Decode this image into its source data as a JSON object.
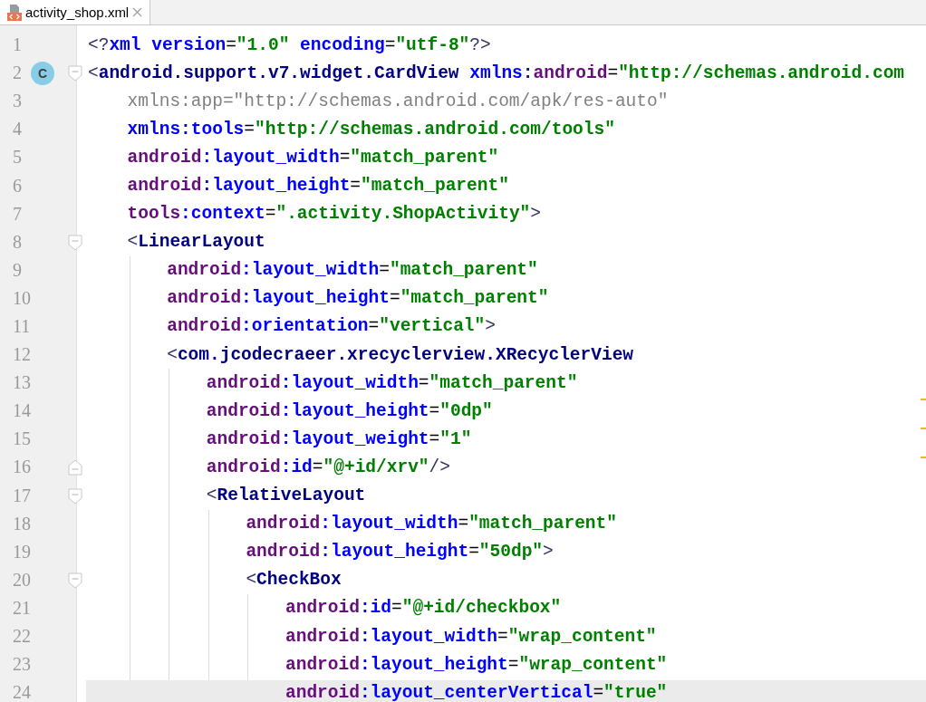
{
  "tabs": [
    {
      "label": "activity_shop.xml",
      "selected": true,
      "closable": true
    }
  ],
  "editor": {
    "lines": [
      {
        "number": "1",
        "current": false,
        "fold_marker": false,
        "tokens": [
          {
            "kind": "bracket",
            "text": "<?"
          },
          {
            "kind": "attr",
            "text": "xml version"
          },
          {
            "kind": "plain",
            "text": "="
          },
          {
            "kind": "value",
            "text": "\"1.0\""
          },
          {
            "kind": "attr",
            "text": " encoding"
          },
          {
            "kind": "plain",
            "text": "="
          },
          {
            "kind": "value",
            "text": "\"utf-8\""
          },
          {
            "kind": "bracket",
            "text": "?>"
          }
        ]
      },
      {
        "number": "2",
        "current": false,
        "fold_marker": true,
        "badge": "C",
        "tokens": [
          {
            "kind": "bracket",
            "text": "<"
          },
          {
            "kind": "tag",
            "text": "android.support.v7.widget.CardView"
          },
          {
            "kind": "attr",
            "text": " xmlns:"
          },
          {
            "kind": "ns",
            "text": "android"
          },
          {
            "kind": "plain",
            "text": "="
          },
          {
            "kind": "value",
            "text": "\"http://schemas.android.com"
          }
        ],
        "children": [
          {
            "number": "3",
            "current": false,
            "fold_marker": false,
            "tokens": [
              {
                "kind": "unused",
                "text": "xmlns:app=\"http://schemas.android.com/apk/res-auto\""
              }
            ]
          },
          {
            "number": "4",
            "current": false,
            "fold_marker": false,
            "tokens": [
              {
                "kind": "attr",
                "text": "xmlns:tools"
              },
              {
                "kind": "plain",
                "text": "="
              },
              {
                "kind": "value",
                "text": "\"http://schemas.android.com/tools\""
              }
            ]
          },
          {
            "number": "5",
            "current": false,
            "fold_marker": false,
            "tokens": [
              {
                "kind": "ns",
                "text": "android"
              },
              {
                "kind": "attr",
                "text": ":layout_width"
              },
              {
                "kind": "plain",
                "text": "="
              },
              {
                "kind": "value",
                "text": "\"match_parent\""
              }
            ]
          },
          {
            "number": "6",
            "current": false,
            "fold_marker": false,
            "tokens": [
              {
                "kind": "ns",
                "text": "android"
              },
              {
                "kind": "attr",
                "text": ":layout_height"
              },
              {
                "kind": "plain",
                "text": "="
              },
              {
                "kind": "value",
                "text": "\"match_parent\""
              }
            ]
          },
          {
            "number": "7",
            "current": false,
            "fold_marker": false,
            "tokens": [
              {
                "kind": "ns",
                "text": "tools"
              },
              {
                "kind": "attr",
                "text": ":context"
              },
              {
                "kind": "plain",
                "text": "="
              },
              {
                "kind": "value",
                "text": "\".activity.ShopActivity\""
              },
              {
                "kind": "bracket",
                "text": ">"
              }
            ]
          },
          {
            "number": "8",
            "current": false,
            "fold_marker": true,
            "tokens": [
              {
                "kind": "bracket",
                "text": "<"
              },
              {
                "kind": "tag",
                "text": "LinearLayout"
              }
            ],
            "children": [
              {
                "number": "9",
                "current": false,
                "fold_marker": false,
                "tokens": [
                  {
                    "kind": "ns",
                    "text": "android"
                  },
                  {
                    "kind": "attr",
                    "text": ":layout_width"
                  },
                  {
                    "kind": "plain",
                    "text": "="
                  },
                  {
                    "kind": "value",
                    "text": "\"match_parent\""
                  }
                ]
              },
              {
                "number": "10",
                "current": false,
                "fold_marker": false,
                "tokens": [
                  {
                    "kind": "ns",
                    "text": "android"
                  },
                  {
                    "kind": "attr",
                    "text": ":layout_height"
                  },
                  {
                    "kind": "plain",
                    "text": "="
                  },
                  {
                    "kind": "value",
                    "text": "\"match_parent\""
                  }
                ]
              },
              {
                "number": "11",
                "current": false,
                "fold_marker": false,
                "tokens": [
                  {
                    "kind": "ns",
                    "text": "android"
                  },
                  {
                    "kind": "attr",
                    "text": ":orientation"
                  },
                  {
                    "kind": "plain",
                    "text": "="
                  },
                  {
                    "kind": "value",
                    "text": "\"vertical\""
                  },
                  {
                    "kind": "bracket",
                    "text": ">"
                  }
                ]
              },
              {
                "number": "12",
                "current": false,
                "fold_marker": false,
                "tokens": [
                  {
                    "kind": "bracket",
                    "text": "<"
                  },
                  {
                    "kind": "tag",
                    "text": "com.jcodecraeer.xrecyclerview.XRecyclerView"
                  }
                ],
                "children": [
                  {
                    "number": "13",
                    "current": false,
                    "fold_marker": false,
                    "tokens": [
                      {
                        "kind": "ns",
                        "text": "android"
                      },
                      {
                        "kind": "attr",
                        "text": ":layout_width"
                      },
                      {
                        "kind": "plain",
                        "text": "="
                      },
                      {
                        "kind": "value",
                        "text": "\"match_parent\""
                      }
                    ]
                  },
                  {
                    "number": "14",
                    "current": false,
                    "fold_marker": false,
                    "tokens": [
                      {
                        "kind": "ns",
                        "text": "android"
                      },
                      {
                        "kind": "attr",
                        "text": ":layout_height"
                      },
                      {
                        "kind": "plain",
                        "text": "="
                      },
                      {
                        "kind": "value",
                        "text": "\"0dp\""
                      }
                    ]
                  },
                  {
                    "number": "15",
                    "current": false,
                    "fold_marker": false,
                    "tokens": [
                      {
                        "kind": "ns",
                        "text": "android"
                      },
                      {
                        "kind": "attr",
                        "text": ":layout_weight"
                      },
                      {
                        "kind": "plain",
                        "text": "="
                      },
                      {
                        "kind": "value",
                        "text": "\"1\""
                      }
                    ]
                  },
                  {
                    "number": "16",
                    "current": false,
                    "fold_marker": true,
                    "fold_closing": true,
                    "tokens": [
                      {
                        "kind": "ns",
                        "text": "android"
                      },
                      {
                        "kind": "attr",
                        "text": ":id"
                      },
                      {
                        "kind": "plain",
                        "text": "="
                      },
                      {
                        "kind": "value",
                        "text": "\"@+id/xrv\""
                      },
                      {
                        "kind": "bracket",
                        "text": "/>"
                      }
                    ]
                  },
                  {
                    "number": "17",
                    "current": false,
                    "fold_marker": true,
                    "tokens": [
                      {
                        "kind": "bracket",
                        "text": "<"
                      },
                      {
                        "kind": "tag",
                        "text": "RelativeLayout"
                      }
                    ],
                    "children": [
                      {
                        "number": "18",
                        "current": false,
                        "fold_marker": false,
                        "tokens": [
                          {
                            "kind": "ns",
                            "text": "android"
                          },
                          {
                            "kind": "attr",
                            "text": ":layout_width"
                          },
                          {
                            "kind": "plain",
                            "text": "="
                          },
                          {
                            "kind": "value",
                            "text": "\"match_parent\""
                          }
                        ]
                      },
                      {
                        "number": "19",
                        "current": false,
                        "fold_marker": false,
                        "tokens": [
                          {
                            "kind": "ns",
                            "text": "android"
                          },
                          {
                            "kind": "attr",
                            "text": ":layout_height"
                          },
                          {
                            "kind": "plain",
                            "text": "="
                          },
                          {
                            "kind": "value",
                            "text": "\"50dp\""
                          },
                          {
                            "kind": "bracket",
                            "text": ">"
                          }
                        ]
                      },
                      {
                        "number": "20",
                        "current": false,
                        "fold_marker": true,
                        "tokens": [
                          {
                            "kind": "bracket",
                            "text": "<"
                          },
                          {
                            "kind": "tag",
                            "text": "CheckBox"
                          }
                        ],
                        "children": [
                          {
                            "number": "21",
                            "current": false,
                            "fold_marker": false,
                            "tokens": [
                              {
                                "kind": "ns",
                                "text": "android"
                              },
                              {
                                "kind": "attr",
                                "text": ":id"
                              },
                              {
                                "kind": "plain",
                                "text": "="
                              },
                              {
                                "kind": "value",
                                "text": "\"@+id/checkbox\""
                              }
                            ]
                          },
                          {
                            "number": "22",
                            "current": false,
                            "fold_marker": false,
                            "tokens": [
                              {
                                "kind": "ns",
                                "text": "android"
                              },
                              {
                                "kind": "attr",
                                "text": ":layout_width"
                              },
                              {
                                "kind": "plain",
                                "text": "="
                              },
                              {
                                "kind": "value",
                                "text": "\"wrap_content\""
                              }
                            ]
                          },
                          {
                            "number": "23",
                            "current": false,
                            "fold_marker": false,
                            "tokens": [
                              {
                                "kind": "ns",
                                "text": "android"
                              },
                              {
                                "kind": "attr",
                                "text": ":layout_height"
                              },
                              {
                                "kind": "plain",
                                "text": "="
                              },
                              {
                                "kind": "value",
                                "text": "\"wrap_content\""
                              }
                            ]
                          },
                          {
                            "number": "24",
                            "current": true,
                            "fold_marker": false,
                            "tokens": [
                              {
                                "kind": "ns",
                                "text": "android"
                              },
                              {
                                "kind": "attr",
                                "text": ":layout_centerVertical"
                              },
                              {
                                "kind": "plain",
                                "text": "="
                              },
                              {
                                "kind": "value",
                                "text": "\"true\""
                              }
                            ]
                          }
                        ]
                      }
                    ]
                  }
                ]
              }
            ]
          }
        ]
      }
    ]
  }
}
